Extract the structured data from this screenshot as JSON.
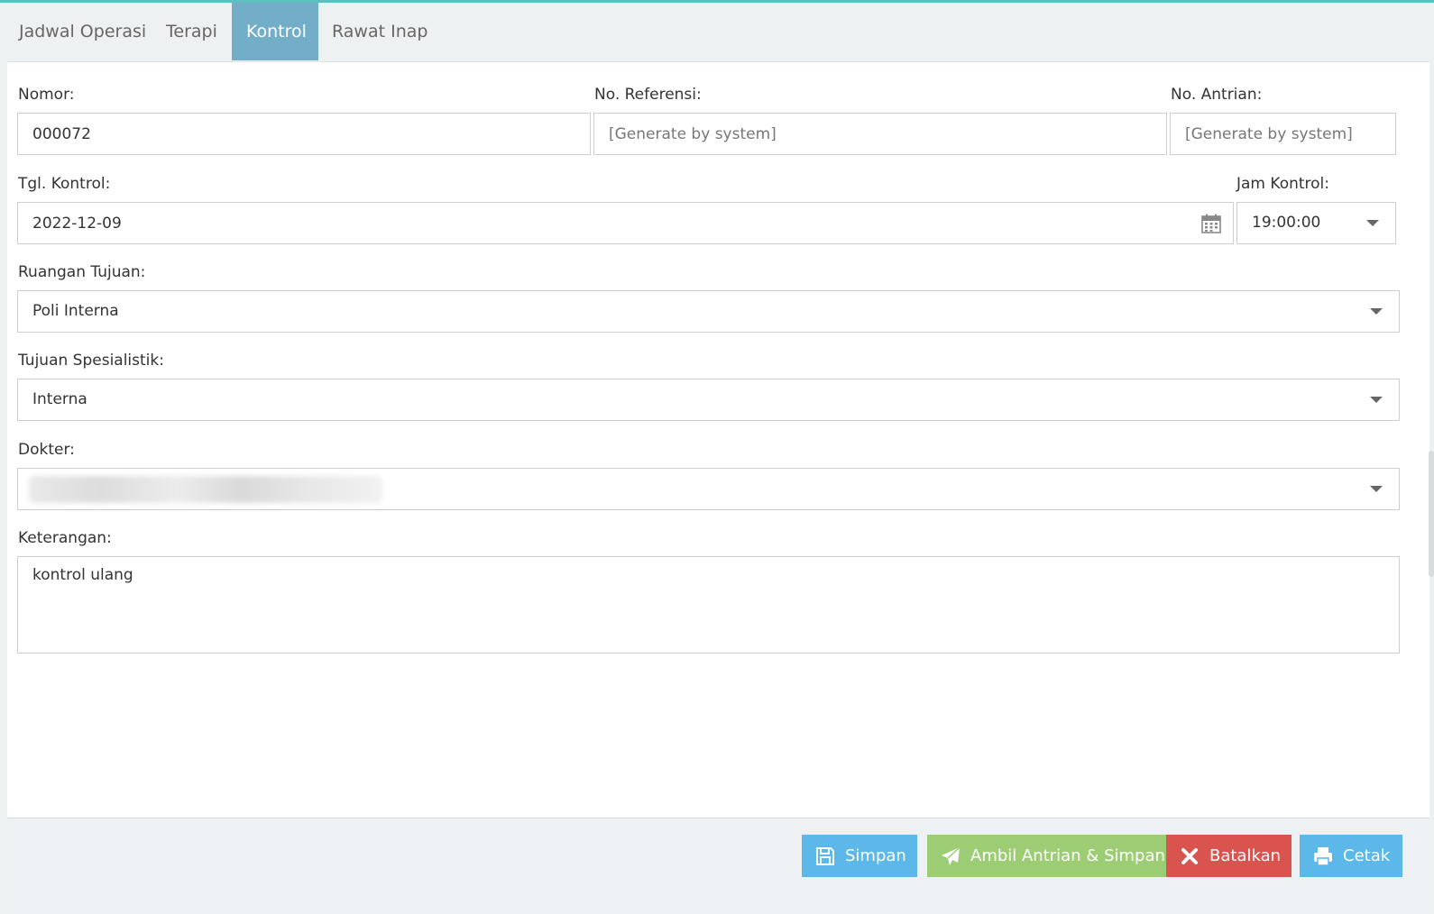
{
  "tabs": [
    {
      "label": "Jadwal Operasi",
      "active": false
    },
    {
      "label": "Terapi",
      "active": false
    },
    {
      "label": "Kontrol",
      "active": true
    },
    {
      "label": "Rawat Inap",
      "active": false
    }
  ],
  "form": {
    "nomor": {
      "label": "Nomor:",
      "value": "000072"
    },
    "no_referensi": {
      "label": "No. Referensi:",
      "placeholder": "[Generate by system]"
    },
    "no_antrian": {
      "label": "No. Antrian:",
      "placeholder": "[Generate by system]"
    },
    "tgl_kontrol": {
      "label": "Tgl. Kontrol:",
      "value": "2022-12-09"
    },
    "jam_kontrol": {
      "label": "Jam Kontrol:",
      "value": "19:00:00"
    },
    "ruangan_tujuan": {
      "label": "Ruangan Tujuan:",
      "value": "Poli Interna"
    },
    "tujuan_spesialistik": {
      "label": "Tujuan Spesialistik:",
      "value": "Interna"
    },
    "dokter": {
      "label": "Dokter:",
      "value": ""
    },
    "keterangan": {
      "label": "Keterangan:",
      "value": "kontrol ulang"
    }
  },
  "buttons": {
    "simpan": {
      "label": "Simpan",
      "color": "#5bb8e8",
      "icon": "floppy-disk-icon"
    },
    "ambil_antrian": {
      "label": "Ambil Antrian & Simpan",
      "color": "#9ccc74",
      "icon": "paper-plane-icon"
    },
    "batalkan": {
      "label": "Batalkan",
      "color": "#d9534f",
      "icon": "close-icon"
    },
    "cetak": {
      "label": "Cetak",
      "color": "#5bb8e8",
      "icon": "printer-icon"
    }
  }
}
